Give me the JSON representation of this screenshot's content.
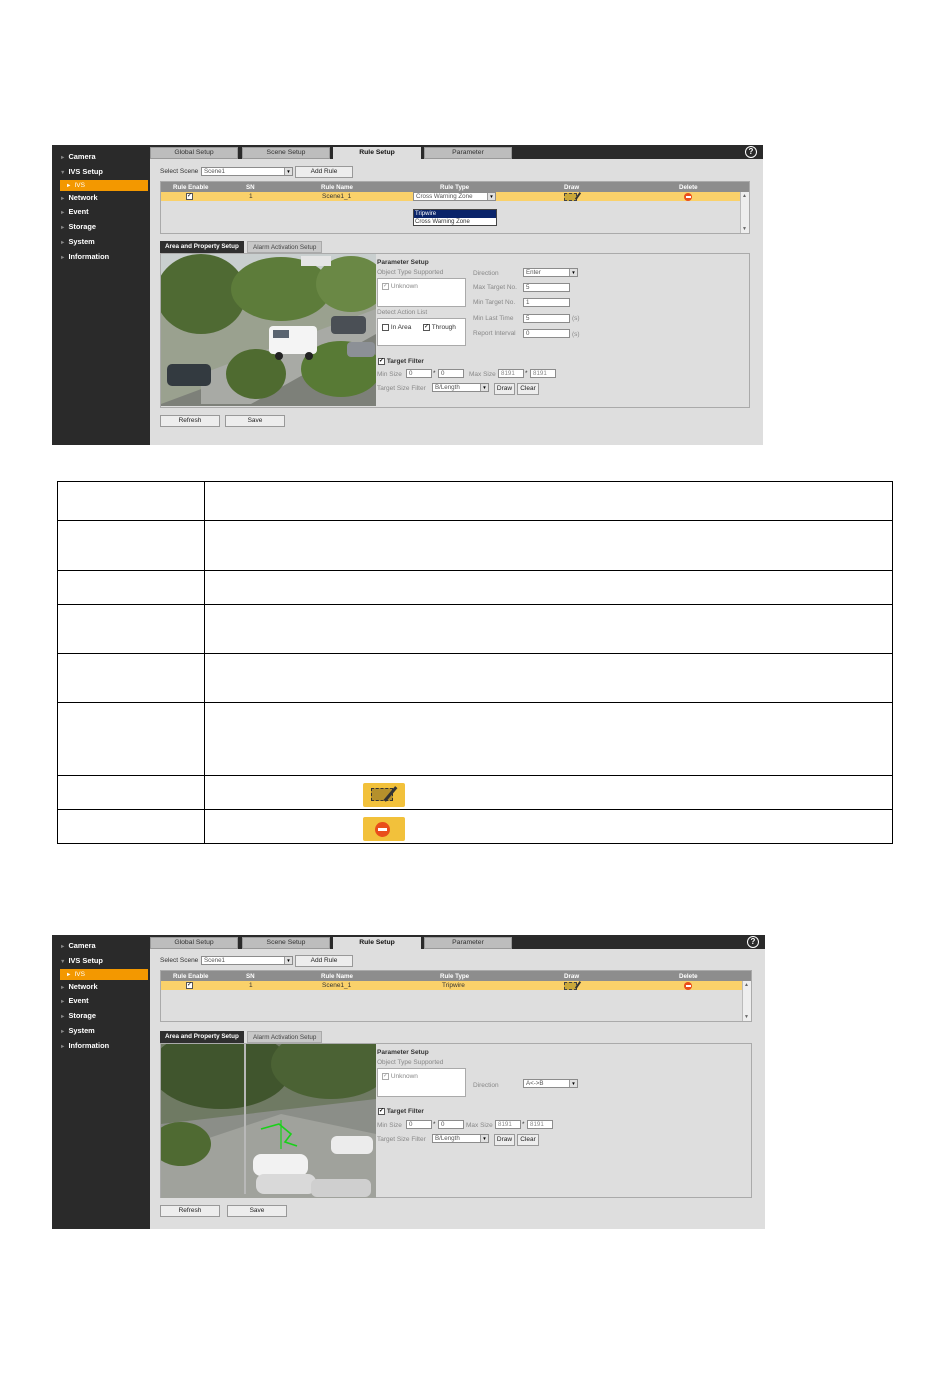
{
  "sidebar": {
    "items": [
      "Camera",
      "IVS Setup",
      "IVS",
      "Network",
      "Event",
      "Storage",
      "System",
      "Information"
    ]
  },
  "tabs": [
    "Global Setup",
    "Scene Setup",
    "Rule Setup",
    "Parameter"
  ],
  "active_tab": "Rule Setup",
  "help_icon": "question-circle-icon",
  "select_scene_label": "Select Scene",
  "scene_value": "Scene1",
  "add_rule_button": "Add Rule",
  "rule_table_headers": [
    "Rule Enable",
    "SN",
    "Rule Name",
    "Rule Type",
    "Draw",
    "Delete"
  ],
  "subtabs": [
    "Area and Property Setup",
    "Alarm Activation Setup"
  ],
  "parameter_setup_title": "Parameter Setup",
  "object_type_label": "Object Type Supported",
  "object_unknown": "Unknown",
  "direction_label": "Direction",
  "target_filter_label": "Target Filter",
  "min_size_label": "Min Size",
  "max_size_label": "Max Size",
  "size_sep": "*",
  "target_size_filter_label": "Target Size Filter",
  "target_size_filter_value": "B/Length",
  "draw_button": "Draw",
  "clear_button": "Clear",
  "refresh_button": "Refresh",
  "save_button": "Save",
  "screen1": {
    "row": {
      "sn": "1",
      "name": "Scene1_1",
      "type": "Cross Warning Zone"
    },
    "type_options": [
      "Tripwire",
      "Cross Warning Zone"
    ],
    "direction_value": "Enter",
    "max_target_label": "Max Target No.",
    "max_target_value": "5",
    "min_target_label": "Min Target No.",
    "min_target_value": "1",
    "min_last_time_label": "Min Last Time",
    "min_last_time_value": "5",
    "report_interval_label": "Report Interval",
    "report_interval_value": "0",
    "unit_s": "(s)",
    "detect_action_label": "Detect Action List",
    "in_area_label": "In Area",
    "through_label": "Through",
    "min_w": "0",
    "min_h": "0",
    "max_w": "8191",
    "max_h": "8191"
  },
  "screen2": {
    "row": {
      "sn": "1",
      "name": "Scene1_1",
      "type": "Tripwire"
    },
    "direction_value": "A<->B",
    "min_w": "0",
    "min_h": "0",
    "max_w": "8191",
    "max_h": "8191"
  },
  "doc_table": {
    "rows": 7,
    "draw_icon": "draw-rule-icon",
    "delete_icon": "delete-rule-icon"
  },
  "colors": {
    "accent": "#f39800",
    "row_highlight": "#fad16a",
    "sidebar": "#2a2a2a"
  }
}
